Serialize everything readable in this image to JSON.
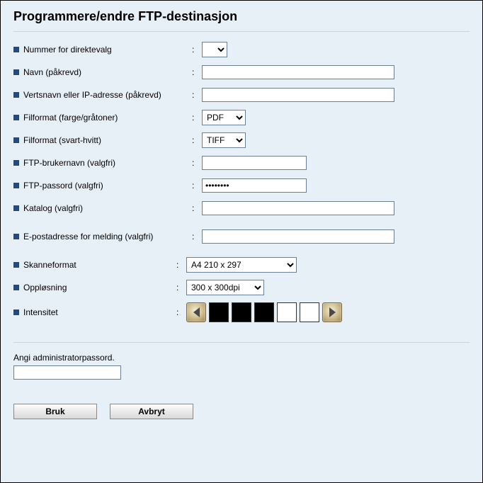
{
  "title": "Programmere/endre FTP-destinasjon",
  "rows": {
    "onetouch": {
      "label": "Nummer for direktevalg",
      "value": ""
    },
    "name": {
      "label": "Navn (påkrevd)",
      "value": ""
    },
    "host": {
      "label": "Vertsnavn eller IP-adresse (påkrevd)",
      "value": ""
    },
    "fmt_color": {
      "label": "Filformat (farge/gråtoner)",
      "value": "PDF"
    },
    "fmt_bw": {
      "label": "Filformat (svart-hvitt)",
      "value": "TIFF"
    },
    "ftp_user": {
      "label": "FTP-brukernavn (valgfri)",
      "value": ""
    },
    "ftp_pass": {
      "label": "FTP-passord (valgfri)",
      "value": "••••••••"
    },
    "dir": {
      "label": "Katalog (valgfri)",
      "value": ""
    },
    "email": {
      "label": "E-postadresse for melding (valgfri)",
      "value": ""
    },
    "scanfmt": {
      "label": "Skanneformat",
      "value": "A4 210 x 297"
    },
    "res": {
      "label": "Oppløsning",
      "value": "300 x 300dpi"
    },
    "intensity": {
      "label": "Intensitet"
    }
  },
  "intensity_swatches": [
    "black",
    "black",
    "black",
    "white",
    "white"
  ],
  "admin": {
    "label": "Angi administratorpassord.",
    "value": ""
  },
  "buttons": {
    "apply": "Bruk",
    "cancel": "Avbryt"
  }
}
